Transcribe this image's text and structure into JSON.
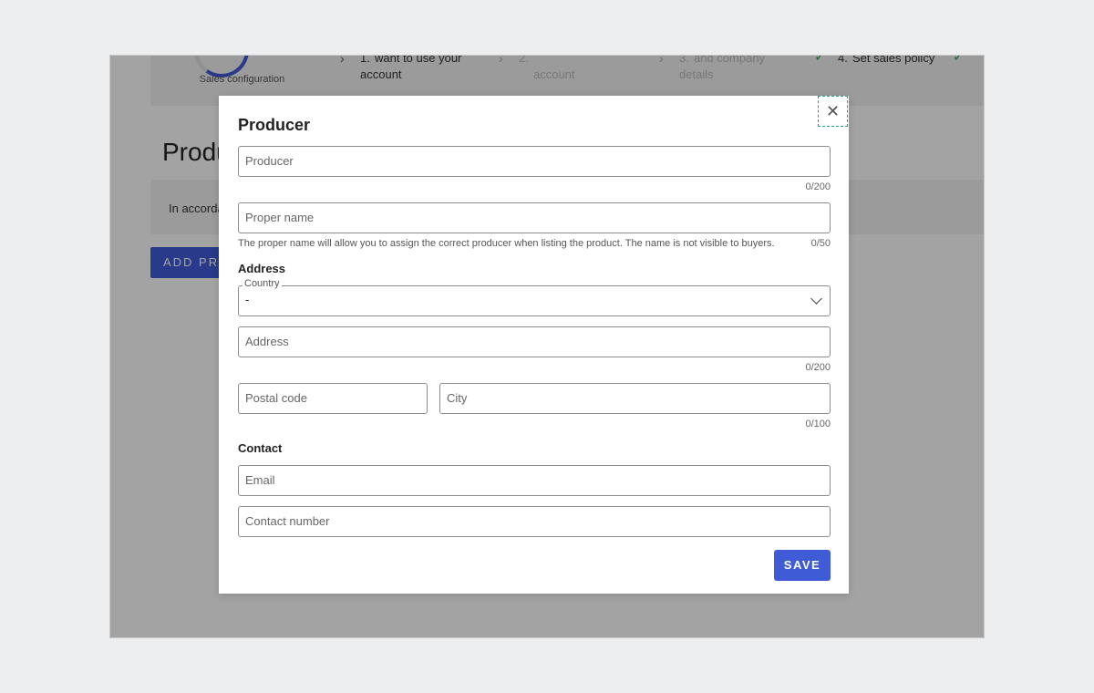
{
  "background": {
    "sales_configuration": "Sales configuration",
    "steps": [
      {
        "num": "1.",
        "label": "want to use your account",
        "state": "chevron"
      },
      {
        "num": "2.",
        "label": "account",
        "state": "chevron"
      },
      {
        "num": "3.",
        "label": "and company details",
        "state": "chevron"
      },
      {
        "num": "4.",
        "label": "Set sales policy",
        "state": "check"
      },
      {
        "num": "",
        "label": "",
        "state": "check"
      }
    ],
    "page_heading": "Produ",
    "banner_text": "In accorda",
    "add_button_label": "ADD PRO"
  },
  "modal": {
    "title": "Producer",
    "close_icon": "close-icon",
    "producer_field": {
      "placeholder": "Producer",
      "value": "",
      "counter": "0/200"
    },
    "proper_name_field": {
      "placeholder": "Proper name",
      "value": "",
      "counter": "0/50",
      "helper": "The proper name will allow you to assign the correct producer when listing the product. The name is not visible to buyers."
    },
    "address_section": "Address",
    "country_select": {
      "label": "Country",
      "value": "-"
    },
    "address_field": {
      "placeholder": "Address",
      "value": "",
      "counter": "0/200"
    },
    "postal_code_field": {
      "placeholder": "Postal code",
      "value": ""
    },
    "city_field": {
      "placeholder": "City",
      "value": "",
      "counter": "0/100"
    },
    "contact_section": "Contact",
    "email_field": {
      "placeholder": "Email",
      "value": ""
    },
    "contact_number_field": {
      "placeholder": "Contact number",
      "value": ""
    },
    "save_label": "SAVE"
  },
  "colors": {
    "accent": "#3f5bd6",
    "check": "#3a9b45",
    "focus_outline": "#2a9d8f"
  }
}
